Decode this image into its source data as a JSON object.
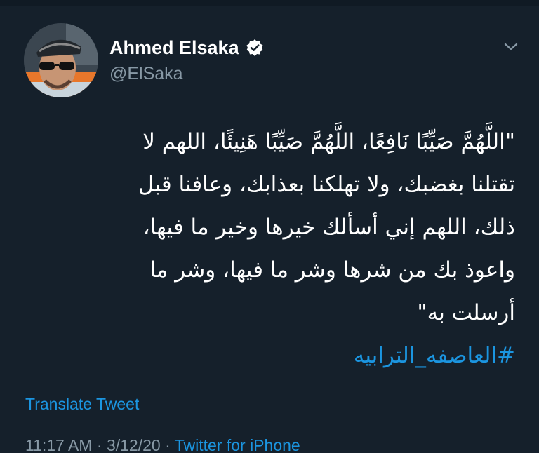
{
  "tweet": {
    "author": {
      "display_name": "Ahmed Elsaka",
      "handle": "@ElSaka",
      "verified_icon": "verified-badge-icon",
      "avatar": "profile-photo"
    },
    "menu_icon": "chevron-down-icon",
    "text_lines": [
      "\"اللَّهُمَّ صَيِّبًا نَافِعًا، اللَّهُمَّ صَيِّبًا هَنِيئًا، اللهم لا",
      "تقتلنا بغضبك، ولا تهلكنا بعذابك، وعافنا قبل",
      "ذلك، اللهم إني أسألك خيرها وخير ما فيها،",
      "واعوذ بك من شرها وشر ما فيها، وشر ما",
      "أرسلت به\""
    ],
    "hashtag": "#العاصفه_الترابيه",
    "translate_label": "Translate Tweet",
    "time": "11:17 AM",
    "date": "3/12/20",
    "separator": " · ",
    "source": "Twitter for iPhone"
  },
  "colors": {
    "background": "#15202b",
    "text": "#ffffff",
    "secondary": "#8899a6",
    "link": "#1b95e0"
  }
}
